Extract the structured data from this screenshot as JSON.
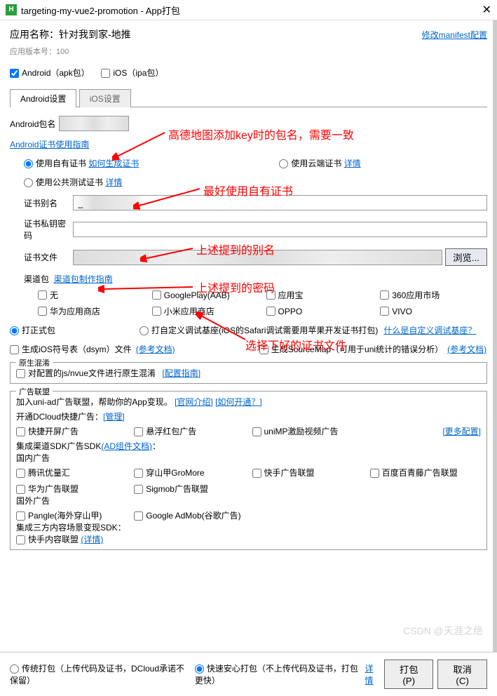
{
  "titlebar": {
    "logo": "H",
    "title": "targeting-my-vue2-promotion - App打包"
  },
  "header": {
    "app_name_label": "应用名称：",
    "app_name_value": "针对我到家-地推",
    "version_label": "应用版本号：",
    "version_value": "100",
    "manifest_link": "修改manifest配置"
  },
  "platforms": {
    "android": "Android（apk包）",
    "ios": "iOS（ipa包）"
  },
  "tabs": {
    "android": "Android设置",
    "ios": "iOS设置"
  },
  "pkg": {
    "label": "Android包名"
  },
  "cert_guide": "Android证书使用指南",
  "cert_radio": {
    "own": "使用自有证书",
    "own_link": "如何生成证书",
    "cloud": "使用云端证书",
    "cloud_link": "详情",
    "public": "使用公共测试证书",
    "public_link": "详情"
  },
  "alias": {
    "label": "证书别名"
  },
  "pwd": {
    "label": "证书私钥密码"
  },
  "file": {
    "label": "证书文件",
    "browse": "浏览..."
  },
  "channel": {
    "label": "渠道包",
    "guide": "渠道包制作指南",
    "items": [
      "无",
      "GooglePlay(AAB)",
      "应用宝",
      "360应用市场",
      "华为应用商店",
      "小米应用商店",
      "OPPO",
      "VIVO"
    ]
  },
  "pkgtype": {
    "official": "打正式包",
    "custom": "打自定义调试基座(iOS的Safari调试需要用苹果开发证书打包)",
    "custom_link": "什么是自定义调试基座？"
  },
  "gen": {
    "dsym": "生成iOS符号表（dsym）文件",
    "dsym_link": "(参考文档)",
    "sourcemap": "生成SourceMap（可用于uni统计的错误分析）",
    "sourcemap_link": "(参考文档)"
  },
  "obf": {
    "title": "原生混淆",
    "cb": "对配置的js/nvue文件进行原生混淆",
    "link": "[配置指南]"
  },
  "ads": {
    "title": "广告联盟",
    "intro": "加入uni-ad广告联盟，帮助你的App变现。",
    "intro_link1": "[官网介绍]",
    "intro_link2": "[如何开通？]",
    "quick": "开通DCloud快捷广告：",
    "quick_link": "[管理]",
    "more": "[更多配置]",
    "row1": [
      "快捷开屏广告",
      "悬浮红包广告",
      "uniMP激励视频广告"
    ],
    "sdk_label": "集成渠道SDK广告SDK",
    "sdk_link": "(AD组件文档)",
    "sdk_colon": "：",
    "domestic": "国内广告",
    "row2": [
      "腾讯优量汇",
      "穿山甲GroMore",
      "快手广告联盟",
      "百度百青藤广告联盟"
    ],
    "row3": [
      "华为广告联盟",
      "Sigmob广告联盟"
    ],
    "foreign": "国外广告",
    "row4": [
      "Pangle(海外穿山甲)",
      "Google AdMob(谷歌广告)"
    ],
    "third": "集成三方内容场景变现SDK：",
    "row5_item": "快手内容联盟",
    "row5_link": "(详情)"
  },
  "footer": {
    "trad": "传统打包（上传代码及证书，DCloud承诺不保留）",
    "fast": "快速安心打包（不上传代码及证书，打包更快）",
    "fast_link": "详情",
    "pack_btn": "打包(P)",
    "cancel_btn": "取消(C)"
  },
  "annotations": {
    "a1": "高德地图添加key时的包名，需要一致",
    "a2": "最好使用自有证书",
    "a3": "上述提到的别名",
    "a4": "上述提到的密码",
    "a5": "选择下好的证书文件"
  },
  "watermark": "CSDN @天涯之绝"
}
